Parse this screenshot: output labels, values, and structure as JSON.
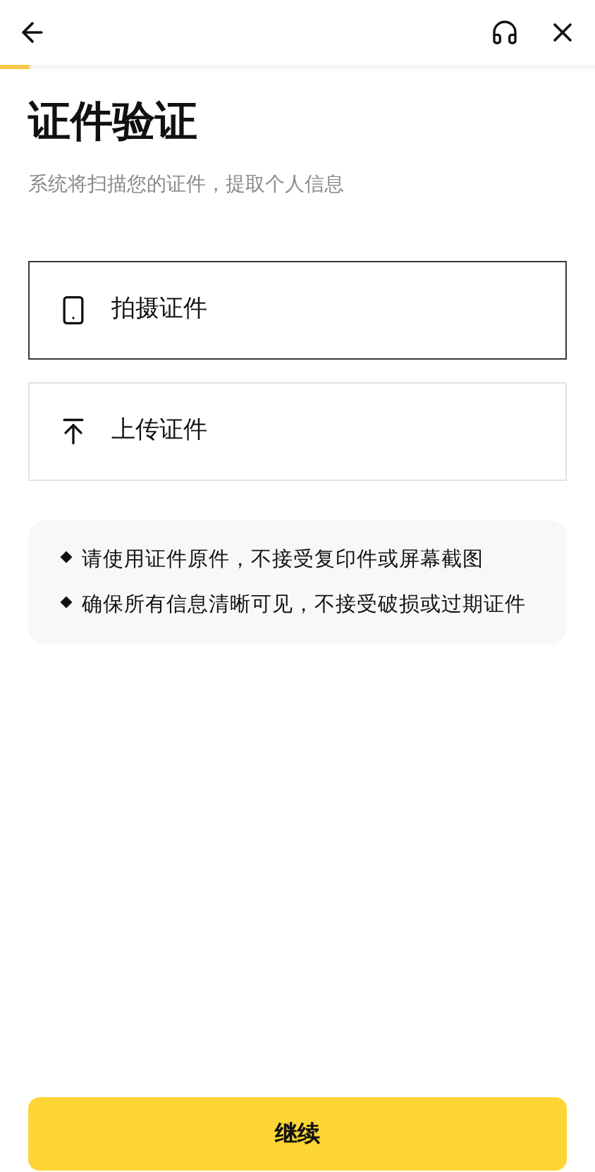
{
  "progress": {
    "level": 0.05
  },
  "title": "证件验证",
  "subtitle": "系统将扫描您的证件，提取个人信息",
  "options": [
    {
      "kind": "camera",
      "label": "拍摄证件",
      "selected": true
    },
    {
      "kind": "upload",
      "label": "上传证件",
      "selected": false
    }
  ],
  "tips": [
    "请使用证件原件，不接受复印件或屏幕截图",
    "确保所有信息清晰可见，不接受破损或过期证件"
  ],
  "button": "继续"
}
